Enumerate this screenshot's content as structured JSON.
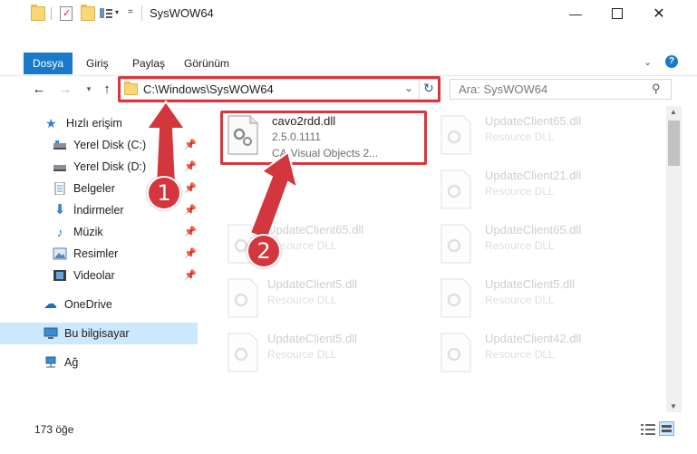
{
  "window": {
    "title": "SysWOW64"
  },
  "ribbon": {
    "tabs": [
      "Dosya",
      "Giriş",
      "Paylaş",
      "Görünüm"
    ]
  },
  "address": {
    "path": "C:\\Windows\\SysWOW64",
    "search_placeholder": "Ara: SysWOW64"
  },
  "sidebar": {
    "items": [
      {
        "label": "Hızlı erişim",
        "icon": "star-icon"
      },
      {
        "label": "Yerel Disk (C:)",
        "icon": "drive-icon",
        "pinned": true
      },
      {
        "label": "Yerel Disk (D:)",
        "icon": "drive-icon",
        "pinned": true
      },
      {
        "label": "Belgeler",
        "icon": "documents-icon",
        "pinned": true
      },
      {
        "label": "İndirmeler",
        "icon": "download-icon",
        "pinned": true
      },
      {
        "label": "Müzik",
        "icon": "music-icon",
        "pinned": true
      },
      {
        "label": "Resimler",
        "icon": "pictures-icon",
        "pinned": true
      },
      {
        "label": "Videolar",
        "icon": "videos-icon",
        "pinned": true
      },
      {
        "label": "OneDrive",
        "icon": "cloud-icon"
      },
      {
        "label": "Bu bilgisayar",
        "icon": "computer-icon",
        "selected": true
      },
      {
        "label": "Ağ",
        "icon": "network-icon"
      }
    ]
  },
  "files": {
    "main": {
      "name": "cavo2rdd.dll",
      "version": "2.5.0.1111",
      "description": "CA-Visual Objects 2..."
    },
    "faded": [
      {
        "name": "UpdateClient65.dll",
        "type": "Resource DLL"
      },
      {
        "name": "UpdateClient21.dll",
        "type": "Resource DLL"
      },
      {
        "name": "UpdateClient65.dll",
        "type": "Resource DLL"
      },
      {
        "name": "UpdateClient65.dll",
        "type": "Resource DLL"
      },
      {
        "name": "UpdateClient5.dll",
        "type": "Resource DLL"
      },
      {
        "name": "UpdateClient5.dll",
        "type": "Resource DLL"
      },
      {
        "name": "UpdateClient5.dll",
        "type": "Resource DLL"
      },
      {
        "name": "UpdateClient42.dll",
        "type": "Resource DLL"
      }
    ]
  },
  "status": {
    "count": "173 öğe"
  },
  "annotations": {
    "step1": "1",
    "step2": "2",
    "highlight_color": "#d9363e"
  }
}
